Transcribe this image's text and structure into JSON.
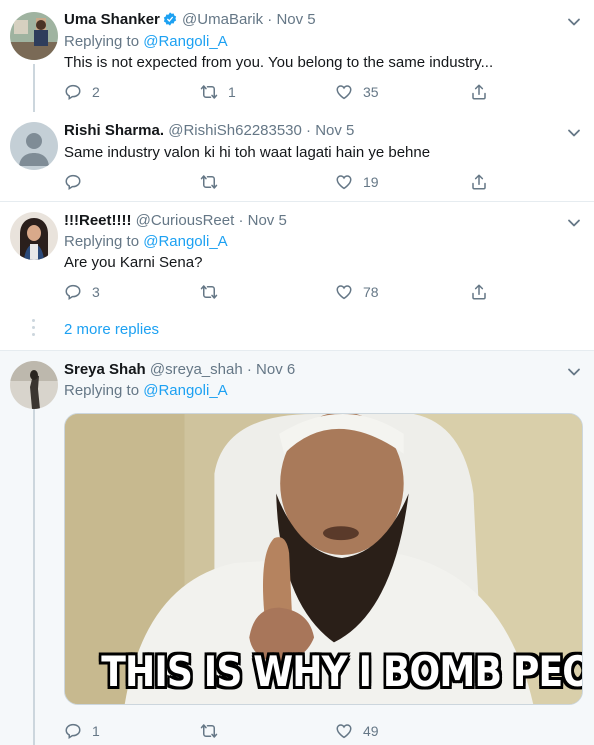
{
  "tweets": [
    {
      "name": "Uma Shanker",
      "handle": "@UmaBarik",
      "date": "Nov 5",
      "verified": true,
      "replying_label": "Replying to",
      "replying_to": "@Rangoli_A",
      "text": "This is not expected from you. You belong to the same industry...",
      "replies": "2",
      "retweets": "1",
      "likes": "35"
    },
    {
      "name": "Rishi Sharma.",
      "handle": "@RishiSh62283530",
      "date": "Nov 5",
      "text": "Same industry valon ki hi toh waat lagati hain ye behne",
      "replies": "",
      "retweets": "",
      "likes": "19"
    },
    {
      "name": "!!!Reet!!!!",
      "handle": "@CuriousReet",
      "date": "Nov 5",
      "replying_label": "Replying to",
      "replying_to": "@Rangoli_A",
      "text": "Are you Karni Sena?",
      "replies": "3",
      "retweets": "",
      "likes": "78"
    },
    {
      "name": "Sreya Shah",
      "handle": "@sreya_shah",
      "date": "Nov 6",
      "replying_label": "Replying to",
      "replying_to": "@Rangoli_A",
      "media_caption": "THIS IS WHY I BOMB PEOPLE",
      "replies": "1",
      "retweets": "",
      "likes": "49"
    }
  ],
  "more_replies": "2 more replies",
  "separator": "·",
  "colors": {
    "accent": "#1da1f2",
    "muted": "#657786",
    "highlight_bg": "#f5f8fa",
    "thread_line": "#ccd6dd"
  },
  "icons": [
    "reply-icon",
    "retweet-icon",
    "like-icon",
    "share-icon",
    "chevron-down-icon",
    "verified-badge-icon"
  ]
}
